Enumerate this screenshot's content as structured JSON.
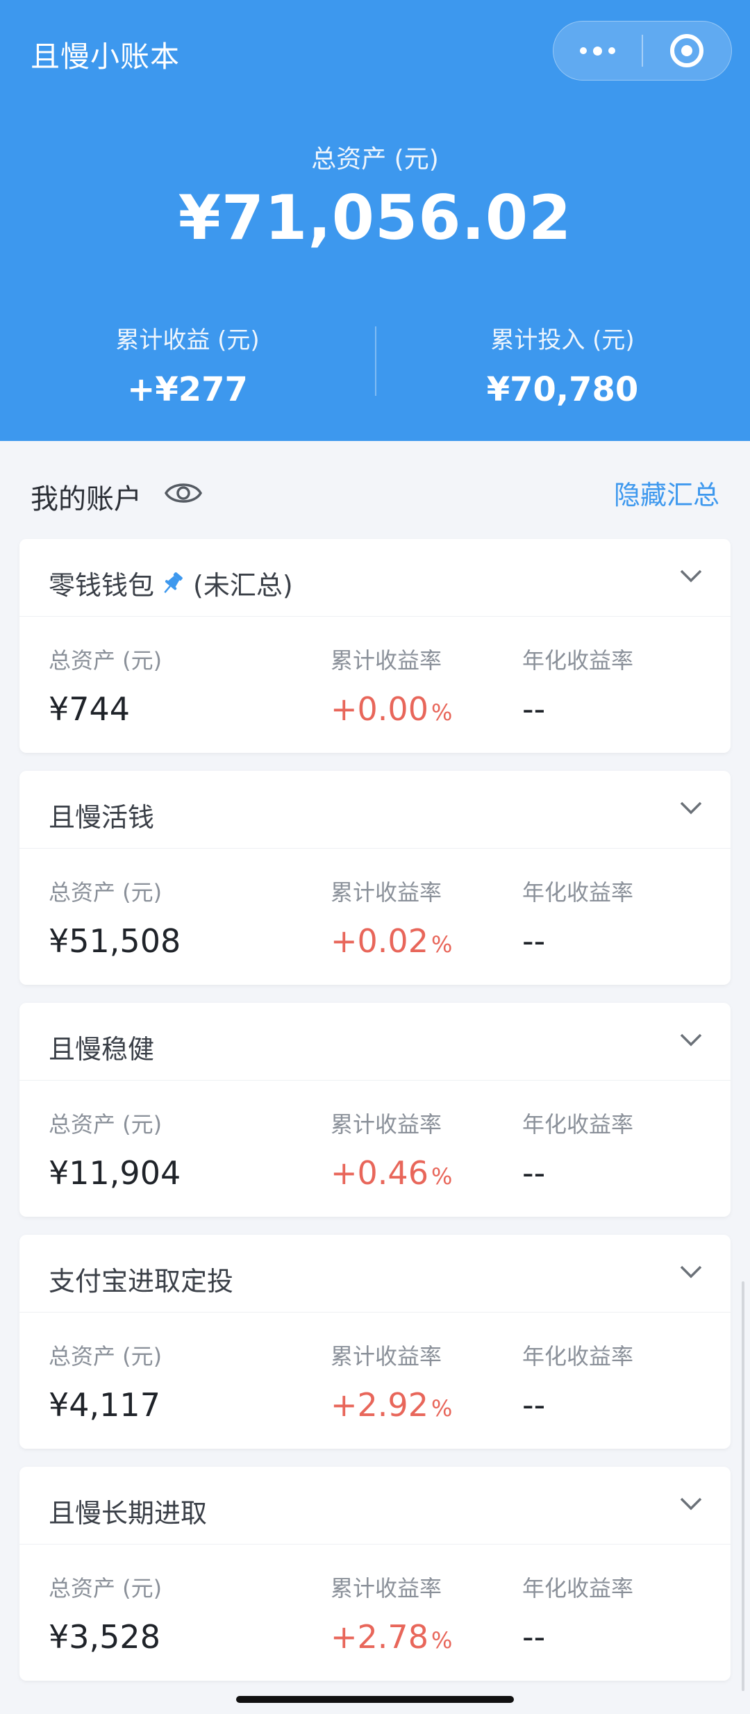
{
  "app": {
    "title": "且慢小账本"
  },
  "header": {
    "total_label": "总资产 (元)",
    "total_value": "¥71,056.02",
    "profit_label": "累计收益 (元)",
    "profit_value": "+¥277",
    "invest_label": "累计投入 (元)",
    "invest_value": "¥70,780"
  },
  "section": {
    "title": "我的账户",
    "hide_summary": "隐藏汇总"
  },
  "labels": {
    "total_assets": "总资产 (元)",
    "cum_return": "累计收益率",
    "annual_return": "年化收益率",
    "pct": "%"
  },
  "colors": {
    "primary": "#3d98ee",
    "positive": "#e8665a"
  },
  "accounts": [
    {
      "name": "零钱钱包",
      "note": "(未汇总)",
      "pinned": true,
      "total": "¥744",
      "cum_return": "+0.00",
      "annual": "--"
    },
    {
      "name": "且慢活钱",
      "note": "",
      "pinned": false,
      "total": "¥51,508",
      "cum_return": "+0.02",
      "annual": "--"
    },
    {
      "name": "且慢稳健",
      "note": "",
      "pinned": false,
      "total": "¥11,904",
      "cum_return": "+0.46",
      "annual": "--"
    },
    {
      "name": "支付宝进取定投",
      "note": "",
      "pinned": false,
      "total": "¥4,117",
      "cum_return": "+2.92",
      "annual": "--"
    },
    {
      "name": "且慢长期进取",
      "note": "",
      "pinned": false,
      "total": "¥3,528",
      "cum_return": "+2.78",
      "annual": "--"
    }
  ]
}
